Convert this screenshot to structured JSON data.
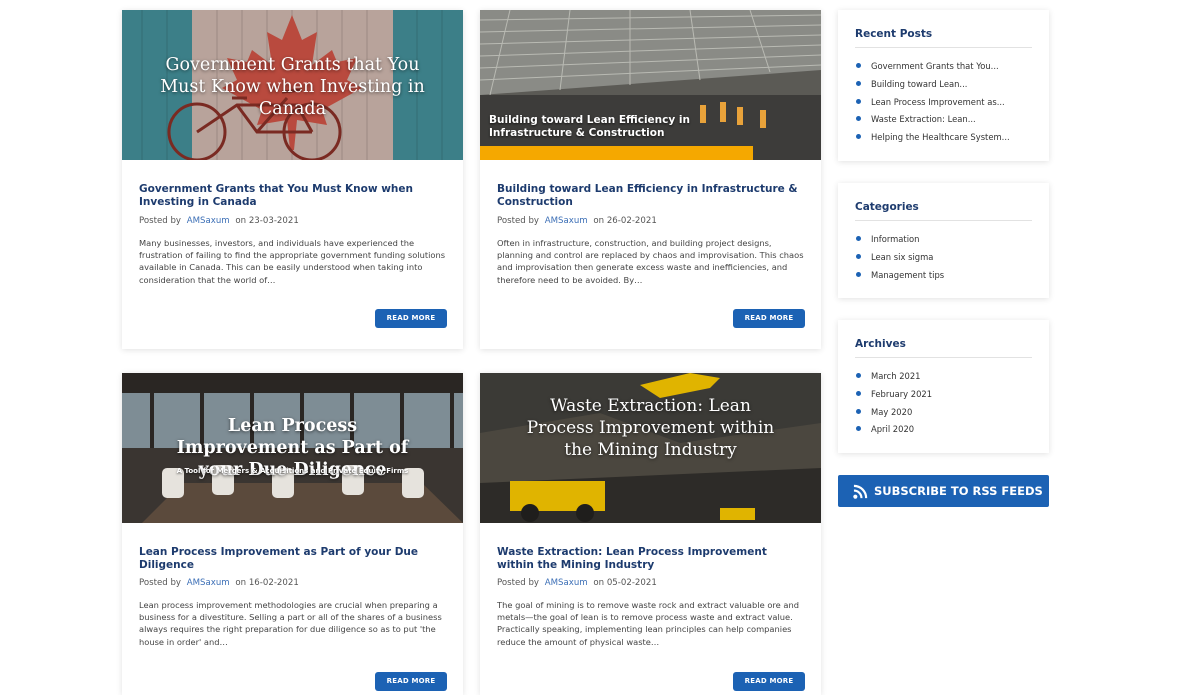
{
  "posts": [
    {
      "image_title": "Government Grants that You Must Know when Investing in Canada",
      "title": "Government Grants that You Must Know when Investing in Canada",
      "posted_by": "Posted by",
      "author": "AMSaxum",
      "on": "on",
      "date": "23-03-2021",
      "excerpt": "Many businesses, investors, and individuals have experienced the frustration of failing to find the appropriate government funding solutions available in Canada. This can be easily understood when taking into consideration that the world of…",
      "button": "READ MORE"
    },
    {
      "image_title": "Building toward Lean Efficiency in Infrastructure & Construction",
      "title": "Building toward Lean Efficiency in Infrastructure & Construction",
      "posted_by": "Posted by",
      "author": "AMSaxum",
      "on": "on",
      "date": "26-02-2021",
      "excerpt": "Often in infrastructure, construction, and building project designs, planning and control are replaced by chaos and improvisation. This chaos and improvisation then generate excess waste and inefficiencies, and therefore need to be avoided. By…",
      "button": "READ MORE"
    },
    {
      "image_title": "Lean Process Improvement as Part of your Due Diligence",
      "image_subtitle": "A Tool for Mergers & Acquisitions and Private Equity Firms",
      "title": "Lean Process Improvement as Part of your Due Diligence",
      "posted_by": "Posted by",
      "author": "AMSaxum",
      "on": "on",
      "date": "16-02-2021",
      "excerpt": "Lean process improvement methodologies are crucial when preparing a business for a divestiture. Selling a part or all of the shares of a business always requires the right preparation for due diligence so as to put 'the house in order' and…",
      "button": "READ MORE"
    },
    {
      "image_title": "Waste Extraction: Lean Process Improvement within the Mining Industry",
      "title": "Waste Extraction: Lean Process Improvement within the Mining Industry",
      "posted_by": "Posted by",
      "author": "AMSaxum",
      "on": "on",
      "date": "05-02-2021",
      "excerpt": "The goal of mining is to remove waste rock and extract valuable ore and metals—the goal of lean is to remove process waste and extract value. Practically speaking, implementing lean principles can help companies reduce the amount of physical waste…",
      "button": "READ MORE"
    }
  ],
  "sidebar": {
    "recent": {
      "title": "Recent Posts",
      "items": [
        "Government Grants that You...",
        "Building toward Lean...",
        "Lean Process Improvement as...",
        "Waste Extraction: Lean...",
        "Helping the Healthcare System..."
      ]
    },
    "categories": {
      "title": "Categories",
      "items": [
        "Information",
        "Lean six sigma",
        "Management tips"
      ]
    },
    "archives": {
      "title": "Archives",
      "items": [
        "March 2021",
        "February 2021",
        "May 2020",
        "April 2020"
      ]
    },
    "rss_label": "SUBSCRIBE TO RSS FEEDS",
    "rss_icon": "rss-icon"
  },
  "colors": {
    "accent": "#1c62b4",
    "heading": "#1d3b6e",
    "highlight_bar": "#f5a800"
  }
}
